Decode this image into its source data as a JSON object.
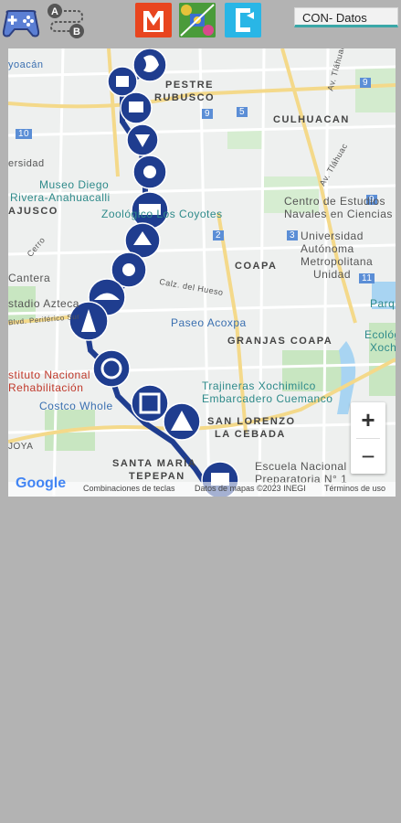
{
  "toolbar": {
    "ab_a": "A",
    "ab_b": "B",
    "datos_button": "CON- Datos"
  },
  "map": {
    "labels": {
      "coyoacan": "yoacán",
      "campestre": "PESTRE",
      "churubusco": "RUBUSCO",
      "culhuacan": "CULHUACAN",
      "av_tlahuac": "Av. Tláhuac",
      "av_tlahuac2": "Av. Tláhuac",
      "reserva": "ersidad",
      "museo1": "Museo Diego",
      "museo2": "Rivera-Anahuacalli",
      "ajusco": "AJUSCO",
      "zoologico": "Zoológico Los Coyotes",
      "centro1": "Centro de Estudios",
      "centro2": "Navales en Ciencias",
      "uam1": "Universidad",
      "uam2": "Autónoma",
      "uam3": "Metropolitana",
      "uam4": "Unidad",
      "coapa": "COAPA",
      "cantera": "Cantera",
      "estadio": "stadio Azteca",
      "paseo": "Paseo Acoxpa",
      "granjas": "GRANJAS COAPA",
      "parque1": "Parque",
      "parque2": "Ecológico",
      "parque3": "Xochimi",
      "instituto1": "stituto Nacional",
      "instituto2": "Rehabilitación",
      "costco": "Costco Whole",
      "trajineras1": "Trajineras Xochimilco",
      "trajineras2": "Embarcadero Cuemanco",
      "san_lorenzo1": "SAN LORENZO",
      "san_lorenzo2": "LA CEBADA",
      "santa_maria1": "SANTA MARÍA",
      "santa_maria2": "TEPEPAN",
      "escuela1": "Escuela Nacional",
      "escuela2": "Preparatoria N° 1",
      "periferico": "Blvd. Periférico Sur",
      "calz": "Calz. del Hueso",
      "joya": "JOYA",
      "cordillera": "Cerro",
      "ctrl_labels": "Combinaciones de teclas",
      "ctrl_data": "Datos de mapas ©2023 INEGI",
      "ctrl_terms": "Términos de uso",
      "google": "Google"
    },
    "road_numbers": [
      "9",
      "5",
      "10",
      "9",
      "9",
      "2",
      "3",
      "11"
    ],
    "zoom_in": "+",
    "zoom_out": "−"
  },
  "colors": {
    "route": "#1f3d8f",
    "station_fill": "#1f3d8f"
  }
}
